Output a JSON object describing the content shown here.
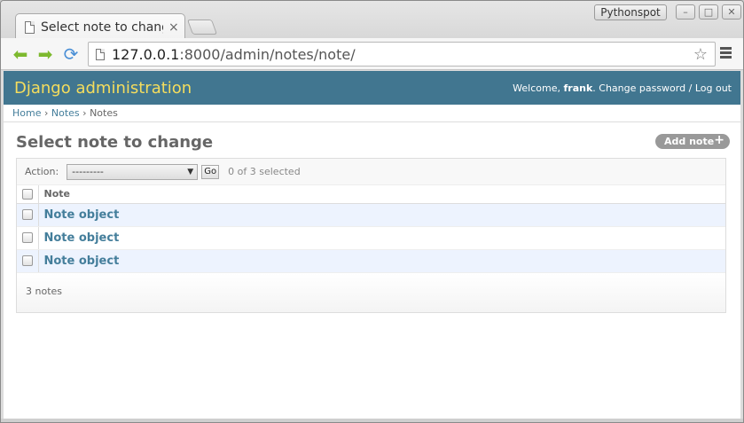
{
  "browser": {
    "tab_title": "Select note to change",
    "tab_close": "×",
    "profile_label": "Pythonspot",
    "url_host": "127.0.0.1",
    "url_path": ":8000/admin/notes/note/"
  },
  "header": {
    "branding": "Django administration",
    "welcome": "Welcome,",
    "username": "frank",
    "change_password": "Change password",
    "separator": "/",
    "logout": "Log out"
  },
  "breadcrumbs": {
    "home": "Home",
    "sep1": "›",
    "app": "Notes",
    "sep2": "›",
    "current": "Notes"
  },
  "content": {
    "title": "Select note to change",
    "add_button": "Add note",
    "add_icon": "+"
  },
  "actions": {
    "label": "Action:",
    "selected_value": "---------",
    "go_label": "Go",
    "counter": "0 of 3 selected"
  },
  "table": {
    "column_header": "Note",
    "rows": [
      "Note object",
      "Note object",
      "Note object"
    ]
  },
  "paginator": {
    "text": "3 notes"
  },
  "colors": {
    "header_bg": "#417690",
    "branding": "#f5dd5d",
    "link": "#447e9b",
    "row_alt": "#edf3fe"
  }
}
